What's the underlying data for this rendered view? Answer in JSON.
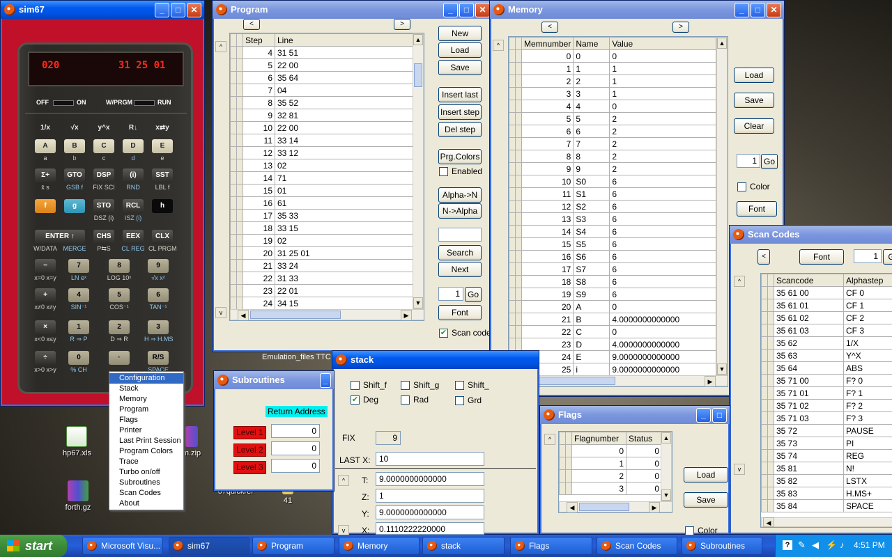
{
  "sim67": {
    "title": "sim67",
    "display_left": "020",
    "display_right": "31 25 01",
    "switch_off": "OFF",
    "switch_on": "ON",
    "switch_prgm": "W/PRGM",
    "switch_run": "RUN",
    "top_labels": [
      "1/x",
      "√x",
      "y^x",
      "R↓",
      "x⇄y"
    ],
    "rows": [
      {
        "keys": [
          "A",
          "B",
          "C",
          "D",
          "E"
        ],
        "subs": [
          "a",
          "b",
          "c",
          "d",
          "e"
        ]
      },
      {
        "keys": [
          "Σ+",
          "GTO",
          "DSP",
          "(i)",
          "SST"
        ],
        "subs": [
          "x̄  s",
          "GSB f",
          "FIX SCI",
          "RND",
          "LBL f"
        ]
      },
      {
        "keys": [
          "f",
          "g",
          "STO",
          "RCL",
          "h"
        ],
        "subs": [
          "",
          "",
          "DSZ (i)",
          "ISZ (i)",
          ""
        ]
      },
      {
        "keys": [
          "ENTER ↑",
          "",
          "CHS",
          "EEX",
          "CLX"
        ],
        "subs": [
          "W/DATA",
          "MERGE",
          "P⇆S",
          "CL REG",
          "CL PRGM"
        ]
      },
      {
        "keys": [
          "−",
          "7",
          "8",
          "9"
        ],
        "subs": [
          "x=0  x=y",
          "LN  eˣ",
          "LOG  10ˣ",
          "√x  x²"
        ]
      },
      {
        "keys": [
          "+",
          "4",
          "5",
          "6"
        ],
        "subs": [
          "x≠0  x≠y",
          "SIN⁻¹",
          "COS⁻¹",
          "TAN⁻¹"
        ]
      },
      {
        "keys": [
          "×",
          "1",
          "2",
          "3"
        ],
        "subs": [
          "x<0  x≤y",
          "R ⇒ P",
          "D ⇒ R",
          "H ⇒ H.MS"
        ]
      },
      {
        "keys": [
          "÷",
          "0",
          "·",
          "R/S"
        ],
        "subs": [
          "x>0  x>y",
          "% CH",
          "",
          "SPACE"
        ]
      }
    ]
  },
  "context_menu": {
    "items": [
      "Configuration",
      "Stack",
      "Memory",
      "Program",
      "Flags",
      "Printer",
      "Last Print Session",
      "Program Colors",
      "Trace",
      "Turbo on/off",
      "Subroutines",
      "Scan Codes",
      "About"
    ],
    "selected": "Configuration"
  },
  "desktop": {
    "icons": [
      "hp67.xls",
      "forth.gz",
      "67quickref",
      "41",
      "m.zip"
    ],
    "emulation_label": "Emulation_files  TTC"
  },
  "program": {
    "title": "Program",
    "nav_left": "<",
    "nav_right": ">",
    "col_step": "Step",
    "col_line": "Line",
    "rows": [
      [
        "4",
        "31 51"
      ],
      [
        "5",
        "22 00"
      ],
      [
        "6",
        "35 64"
      ],
      [
        "7",
        "04"
      ],
      [
        "8",
        "35 52"
      ],
      [
        "9",
        "32 81"
      ],
      [
        "10",
        "22 00"
      ],
      [
        "11",
        "33 14"
      ],
      [
        "12",
        "33 12"
      ],
      [
        "13",
        "02"
      ],
      [
        "14",
        "71"
      ],
      [
        "15",
        "01"
      ],
      [
        "16",
        "61"
      ],
      [
        "17",
        "35 33"
      ],
      [
        "18",
        "33 15"
      ],
      [
        "19",
        "02"
      ],
      [
        "20",
        "31 25 01"
      ],
      [
        "21",
        "33 24"
      ],
      [
        "22",
        "31 33"
      ],
      [
        "23",
        "22 01"
      ],
      [
        "24",
        "34 15"
      ]
    ],
    "buttons": [
      "New",
      "Load",
      "Save",
      "Insert last",
      "Insert step",
      "Del step",
      "Prg.Colors"
    ],
    "enabled_label": "Enabled",
    "alpha_n": "Alpha->N",
    "n_alpha": "N->Alpha",
    "search_value": "",
    "search_btn": "Search",
    "next_btn": "Next",
    "goto_value": "1",
    "go_btn": "Go",
    "font_btn": "Font",
    "scan_label": "Scan code",
    "scan_checked": true
  },
  "memory": {
    "title": "Memory",
    "nav_left": "<",
    "nav_right": ">",
    "cols": [
      "Memnumber",
      "Name",
      "Value"
    ],
    "rows": [
      [
        "0",
        "0",
        "0"
      ],
      [
        "1",
        "1",
        "1"
      ],
      [
        "2",
        "2",
        "1"
      ],
      [
        "3",
        "3",
        "1"
      ],
      [
        "4",
        "4",
        "0"
      ],
      [
        "5",
        "5",
        "2"
      ],
      [
        "6",
        "6",
        "2"
      ],
      [
        "7",
        "7",
        "2"
      ],
      [
        "8",
        "8",
        "2"
      ],
      [
        "9",
        "9",
        "2"
      ],
      [
        "10",
        "S0",
        "6"
      ],
      [
        "11",
        "S1",
        "6"
      ],
      [
        "12",
        "S2",
        "6"
      ],
      [
        "13",
        "S3",
        "6"
      ],
      [
        "14",
        "S4",
        "6"
      ],
      [
        "15",
        "S5",
        "6"
      ],
      [
        "16",
        "S6",
        "6"
      ],
      [
        "17",
        "S7",
        "6"
      ],
      [
        "18",
        "S8",
        "6"
      ],
      [
        "19",
        "S9",
        "6"
      ],
      [
        "20",
        "A",
        "0"
      ],
      [
        "21",
        "B",
        "   4.0000000000000"
      ],
      [
        "22",
        "C",
        "0"
      ],
      [
        "23",
        "D",
        "   4.0000000000000"
      ],
      [
        "24",
        "E",
        "   9.0000000000000"
      ],
      [
        "25",
        "i",
        "   9.0000000000000"
      ]
    ],
    "load_btn": "Load",
    "save_btn": "Save",
    "clear_btn": "Clear",
    "goto_value": "1",
    "go_btn": "Go",
    "color_label": "Color",
    "font_btn": "Font"
  },
  "stack": {
    "title": "stack",
    "shift_f": "Shift_f",
    "shift_g": "Shift_g",
    "shift_h": "Shift_",
    "deg": "Deg",
    "rad": "Rad",
    "grd": "Grd",
    "fix_label": "FIX",
    "fix_value": "9",
    "lastx_label": "LAST X:",
    "lastx_value": "10",
    "t_label": "T:",
    "t_value": "9.0000000000000",
    "z_label": "Z:",
    "z_value": "1",
    "y_label": "Y:",
    "y_value": "9.0000000000000",
    "x_label": "X:",
    "x_value": "0.1110222220000"
  },
  "subroutines": {
    "title": "Subroutines",
    "return_label": "Return Address",
    "levels": [
      [
        "Level 1",
        "0"
      ],
      [
        "Level 2",
        "0"
      ],
      [
        "Level 3",
        "0"
      ]
    ]
  },
  "flags": {
    "title": "Flags",
    "cols": [
      "Flagnumber",
      "Status"
    ],
    "rows": [
      [
        "0",
        "0"
      ],
      [
        "1",
        "0"
      ],
      [
        "2",
        "0"
      ],
      [
        "3",
        "0"
      ]
    ],
    "load_btn": "Load",
    "save_btn": "Save",
    "color_label": "Color"
  },
  "scancodes": {
    "title": "Scan Codes",
    "nav_left": "<",
    "font_btn": "Font",
    "goto_value": "1",
    "go_btn": "G",
    "cols": [
      "Scancode",
      "Alphastep"
    ],
    "rows": [
      [
        "35 61 00",
        "CF 0"
      ],
      [
        "35 61 01",
        "CF 1"
      ],
      [
        "35 61 02",
        "CF 2"
      ],
      [
        "35 61 03",
        "CF 3"
      ],
      [
        "35 62",
        "1/X"
      ],
      [
        "35 63",
        "Y^X"
      ],
      [
        "35 64",
        "ABS"
      ],
      [
        "35 71 00",
        "F? 0"
      ],
      [
        "35 71 01",
        "F? 1"
      ],
      [
        "35 71 02",
        "F? 2"
      ],
      [
        "35 71 03",
        "F? 3"
      ],
      [
        "35 72",
        "PAUSE"
      ],
      [
        "35 73",
        "PI"
      ],
      [
        "35 74",
        "REG"
      ],
      [
        "35 81",
        "N!"
      ],
      [
        "35 82",
        "LSTX"
      ],
      [
        "35 83",
        "H.MS+"
      ],
      [
        "35 84",
        "SPACE"
      ]
    ]
  },
  "taskbar": {
    "start": "start",
    "buttons": [
      "Microsoft Visu...",
      "sim67",
      "Program",
      "Memory",
      "stack",
      "Flags",
      "Scan Codes",
      "Subroutines"
    ],
    "active": "sim67",
    "clock": "4:51 PM"
  }
}
